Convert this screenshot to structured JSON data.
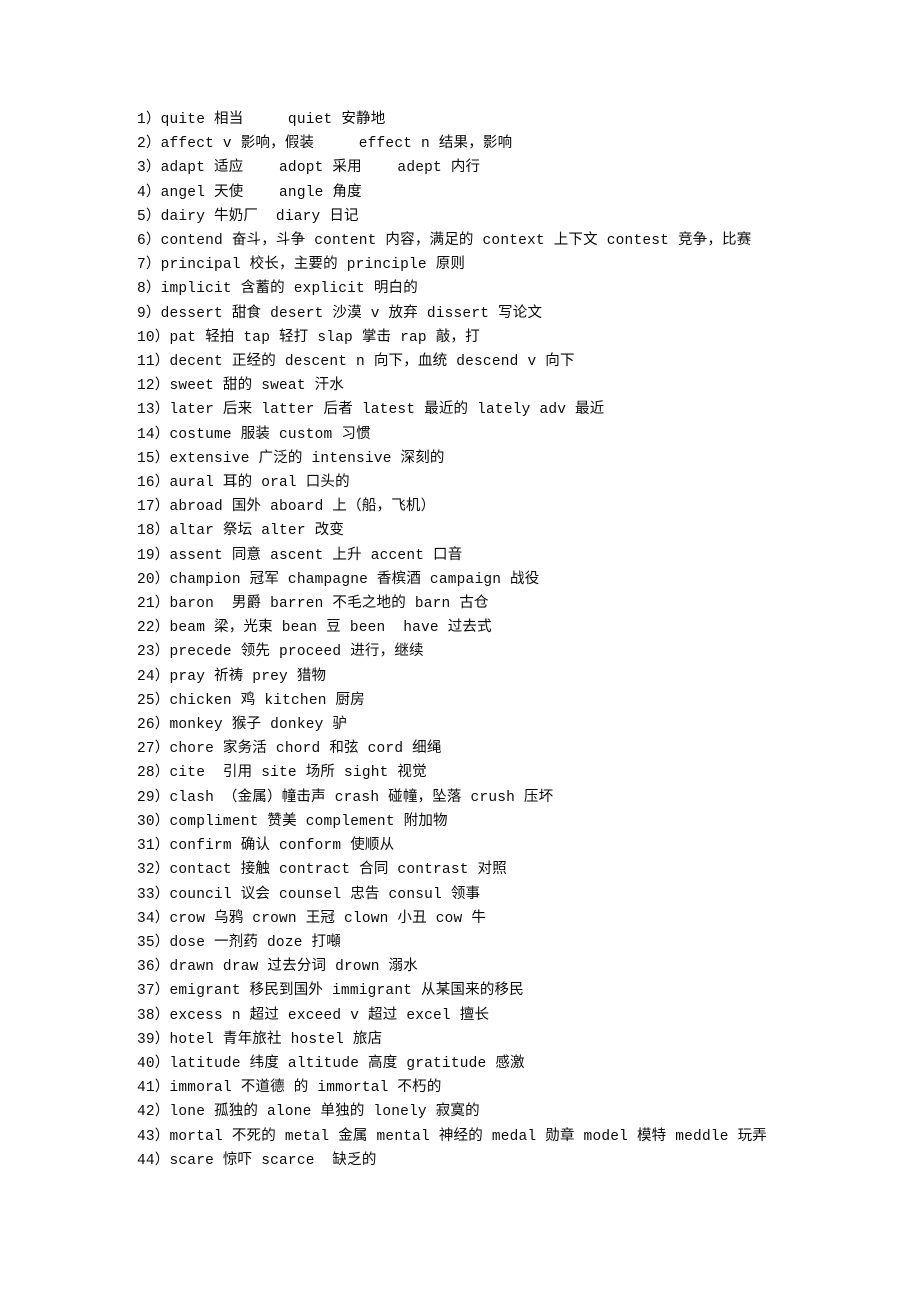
{
  "document": {
    "page_background": "#ffffff",
    "text_color": "#0a0a0a",
    "lines": [
      {
        "index": "1）",
        "text": "1）quite 相当     quiet 安静地"
      },
      {
        "index": "2）",
        "text": "2）affect v 影响，假装     effect n 结果，影响"
      },
      {
        "index": "3）",
        "text": "3）adapt 适应    adopt 采用    adept 内行"
      },
      {
        "index": "4）",
        "text": "4）angel 天使    angle 角度"
      },
      {
        "index": "5）",
        "text": "5）dairy 牛奶厂  diary 日记"
      },
      {
        "index": "6）",
        "text": "6）contend 奋斗，斗争 content 内容，满足的 context 上下文 contest 竞争，比赛"
      },
      {
        "index": "7）",
        "text": "7）principal 校长，主要的 principle 原则"
      },
      {
        "index": "8）",
        "text": "8）implicit 含蓄的 explicit 明白的"
      },
      {
        "index": "9）",
        "text": "9）dessert 甜食 desert 沙漠 v 放弃 dissert 写论文"
      },
      {
        "index": "10）",
        "text": "10）pat 轻拍 tap 轻打 slap 掌击 rap 敲，打"
      },
      {
        "index": "11）",
        "text": "11）decent 正经的 descent n 向下，血统 descend v 向下"
      },
      {
        "index": "12）",
        "text": "12）sweet 甜的 sweat 汗水"
      },
      {
        "index": "13）",
        "text": "13）later 后来 latter 后者 latest 最近的 lately adv 最近"
      },
      {
        "index": "14）",
        "text": "14）costume 服装 custom 习惯"
      },
      {
        "index": "15）",
        "text": "15）extensive 广泛的 intensive 深刻的"
      },
      {
        "index": "16）",
        "text": "16）aural 耳的 oral 口头的"
      },
      {
        "index": "17）",
        "text": "17）abroad 国外 aboard 上（船，飞机）"
      },
      {
        "index": "18）",
        "text": "18）altar 祭坛 alter 改变"
      },
      {
        "index": "19）",
        "text": "19）assent 同意 ascent 上升 accent 口音"
      },
      {
        "index": "20）",
        "text": "20）champion 冠军 champagne 香槟酒 campaign 战役"
      },
      {
        "index": "21）",
        "text": "21）baron  男爵 barren 不毛之地的 barn 古仓"
      },
      {
        "index": "22）",
        "text": "22）beam 梁，光束 bean 豆 been  have 过去式"
      },
      {
        "index": "23）",
        "text": "23）precede 领先 proceed 进行，继续"
      },
      {
        "index": "24）",
        "text": "24）pray 祈祷 prey 猎物"
      },
      {
        "index": "25）",
        "text": "25）chicken 鸡 kitchen 厨房"
      },
      {
        "index": "26）",
        "text": "26）monkey 猴子 donkey 驴"
      },
      {
        "index": "27）",
        "text": "27）chore 家务活 chord 和弦 cord 细绳"
      },
      {
        "index": "28）",
        "text": "28）cite  引用 site 场所 sight 视觉"
      },
      {
        "index": "29）",
        "text": "29）clash （金属）幢击声 crash 碰幢，坠落 crush 压坏"
      },
      {
        "index": "30）",
        "text": "30）compliment 赞美 complement 附加物"
      },
      {
        "index": "31）",
        "text": "31）confirm 确认 conform 使顺从"
      },
      {
        "index": "32）",
        "text": "32）contact 接触 contract 合同 contrast 对照"
      },
      {
        "index": "33）",
        "text": "33）council 议会 counsel 忠告 consul 领事"
      },
      {
        "index": "34）",
        "text": "34）crow 乌鸦 crown 王冠 clown 小丑 cow 牛"
      },
      {
        "index": "35）",
        "text": "35）dose 一剂药 doze 打噸"
      },
      {
        "index": "36）",
        "text": "36）drawn draw 过去分词 drown 溺水"
      },
      {
        "index": "37）",
        "text": "37）emigrant 移民到国外 immigrant 从某国来的移民"
      },
      {
        "index": "38）",
        "text": "38）excess n 超过 exceed v 超过 excel 擅长"
      },
      {
        "index": "39）",
        "text": "39）hotel 青年旅社 hostel 旅店"
      },
      {
        "index": "40）",
        "text": "40）latitude 纬度 altitude 高度 gratitude 感激"
      },
      {
        "index": "41）",
        "text": "41）immoral 不道德 的 immortal 不朽的"
      },
      {
        "index": "42）",
        "text": "42）lone 孤独的 alone 单独的 lonely 寂寞的"
      },
      {
        "index": "43）",
        "text": "43）mortal 不死的 metal 金属 mental 神经的 medal 勋章 model 模特 meddle 玩弄"
      },
      {
        "index": "44）",
        "text": "44）scare 惊吓 scarce  缺乏的"
      }
    ]
  }
}
